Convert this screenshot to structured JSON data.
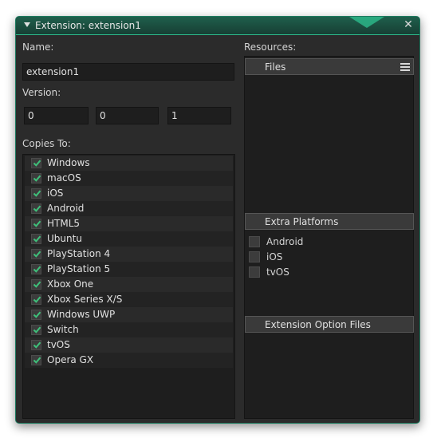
{
  "window": {
    "title": "Extension: extension1",
    "close_glyph": "✕"
  },
  "form": {
    "name_label": "Name:",
    "name_value": "extension1",
    "version_label": "Version:",
    "version": [
      "0",
      "0",
      "1"
    ],
    "copies_label": "Copies To:",
    "copies": [
      {
        "label": "Windows",
        "checked": true
      },
      {
        "label": "macOS",
        "checked": true
      },
      {
        "label": "iOS",
        "checked": true
      },
      {
        "label": "Android",
        "checked": true
      },
      {
        "label": "HTML5",
        "checked": true
      },
      {
        "label": "Ubuntu",
        "checked": true
      },
      {
        "label": "PlayStation 4",
        "checked": true
      },
      {
        "label": "PlayStation 5",
        "checked": true
      },
      {
        "label": "Xbox One",
        "checked": true
      },
      {
        "label": "Xbox Series X/S",
        "checked": true
      },
      {
        "label": "Windows UWP",
        "checked": true
      },
      {
        "label": "Switch",
        "checked": true
      },
      {
        "label": "tvOS",
        "checked": true
      },
      {
        "label": "Opera GX",
        "checked": true
      }
    ]
  },
  "resources": {
    "label": "Resources:",
    "files_header": "Files",
    "extra_platforms_header": "Extra Platforms",
    "extra_platforms": [
      {
        "label": "Android",
        "checked": false
      },
      {
        "label": "iOS",
        "checked": false
      },
      {
        "label": "tvOS",
        "checked": false
      }
    ],
    "option_files_header": "Extension Option Files"
  },
  "colors": {
    "accent": "#2dbb8c",
    "check": "#3fc07a"
  }
}
